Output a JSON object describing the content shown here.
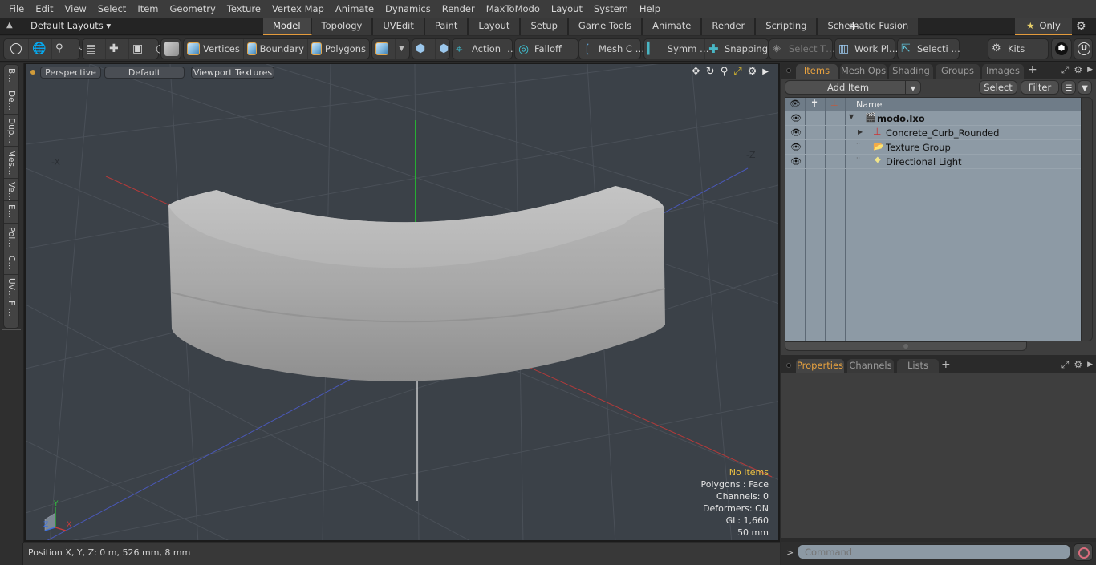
{
  "menubar": {
    "items": [
      "File",
      "Edit",
      "View",
      "Select",
      "Item",
      "Geometry",
      "Texture",
      "Vertex Map",
      "Animate",
      "Dynamics",
      "Render",
      "MaxToModo",
      "Layout",
      "System",
      "Help"
    ]
  },
  "layoutbar": {
    "layout_select": "Default Layouts ▾",
    "tabs": [
      "Model",
      "Topology",
      "UVEdit",
      "Paint",
      "Layout",
      "Setup",
      "Game Tools",
      "Animate",
      "Render",
      "Scripting",
      "Schematic Fusion"
    ],
    "active_tab": "Model",
    "add_label": "+",
    "only_label": "Only",
    "accent_color": "#e49b3c"
  },
  "toolbar": {
    "vertices": "Vertices",
    "boundary": "Boundary",
    "polygons": "Polygons",
    "action": "Action",
    "action_more": "…",
    "falloff": "Falloff",
    "mesh_constraints": "Mesh C …",
    "symmetry": "Symm …",
    "snapping": "Snapping",
    "select_through": "Select T…",
    "work_plane": "Work Pl…",
    "selection_sets": "Selecti …",
    "kits": "Kits"
  },
  "left_strip": {
    "tabs": [
      "B…",
      "De…",
      "Dup…",
      "Mes…",
      "Ve…",
      "E…",
      "Pol…",
      "C…",
      "UV…",
      "F …"
    ]
  },
  "viewport": {
    "view_mode": "Perspective",
    "shading": "Default",
    "textures": "Viewport Textures",
    "axis_labels": {
      "neg_x": "-X",
      "neg_z": "-Z",
      "gizmo_x": "X",
      "gizmo_y": "Y",
      "gizmo_z": "Z"
    },
    "stats": {
      "selection": "No Items",
      "polygons": "Polygons : Face",
      "channels": "Channels: 0",
      "deformers": "Deformers: ON",
      "gl": "GL: 1,660",
      "scale": "50 mm"
    }
  },
  "statusbar": {
    "position": "Position X, Y, Z:   0 m, 526 mm, 8 mm"
  },
  "items_panel": {
    "tabs": [
      "Items",
      "Mesh Ops",
      "Shading",
      "Groups",
      "Images"
    ],
    "active_tab": "Items",
    "add_item": "Add Item",
    "select": "Select",
    "filter": "Filter",
    "column_name": "Name",
    "tree": [
      {
        "label": "modo.lxo",
        "icon": "scene-clapper-icon",
        "bold": true,
        "expand": "expanded"
      },
      {
        "label": "Concrete_Curb_Rounded",
        "icon": "mesh-axes-icon",
        "bold": false,
        "expand": "collapsed"
      },
      {
        "label": "Texture Group",
        "icon": "folder-icon",
        "bold": false,
        "expand": "none"
      },
      {
        "label": "Directional Light",
        "icon": "light-icon",
        "bold": false,
        "expand": "none"
      }
    ]
  },
  "properties_panel": {
    "tabs": [
      "Properties",
      "Channels",
      "Lists"
    ],
    "active_tab": "Properties"
  },
  "command": {
    "prompt": ">",
    "placeholder": "Command"
  }
}
